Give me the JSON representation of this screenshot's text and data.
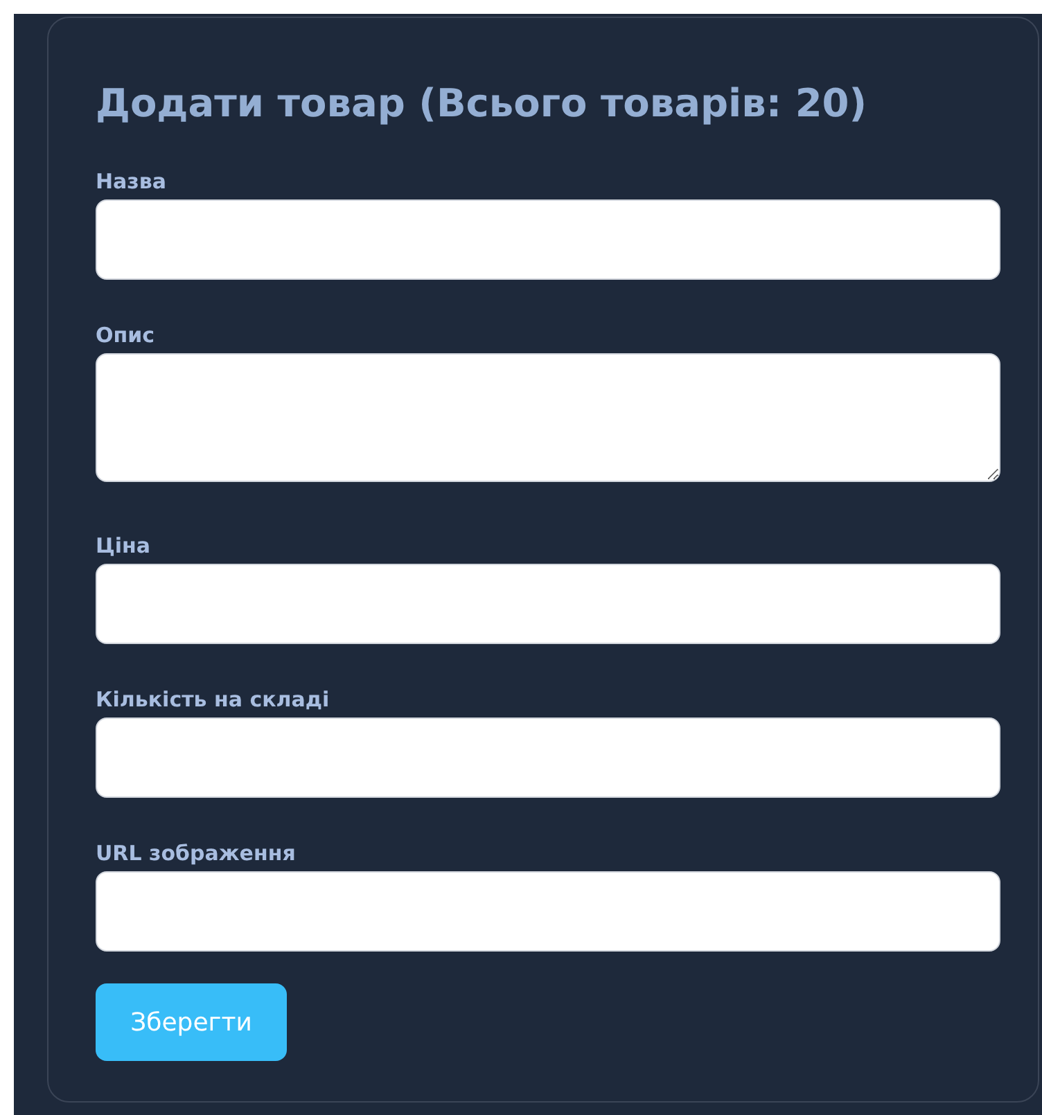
{
  "form": {
    "title": "Додати товар (Всього товарів: 20)",
    "fields": [
      {
        "label": "Назва",
        "kind": "text"
      },
      {
        "label": "Опис",
        "kind": "textarea"
      },
      {
        "label": "Ціна",
        "kind": "text"
      },
      {
        "label": "Кількість на складі",
        "kind": "text"
      },
      {
        "label": "URL зображення",
        "kind": "text"
      }
    ],
    "submit_button": "Зберегти"
  }
}
